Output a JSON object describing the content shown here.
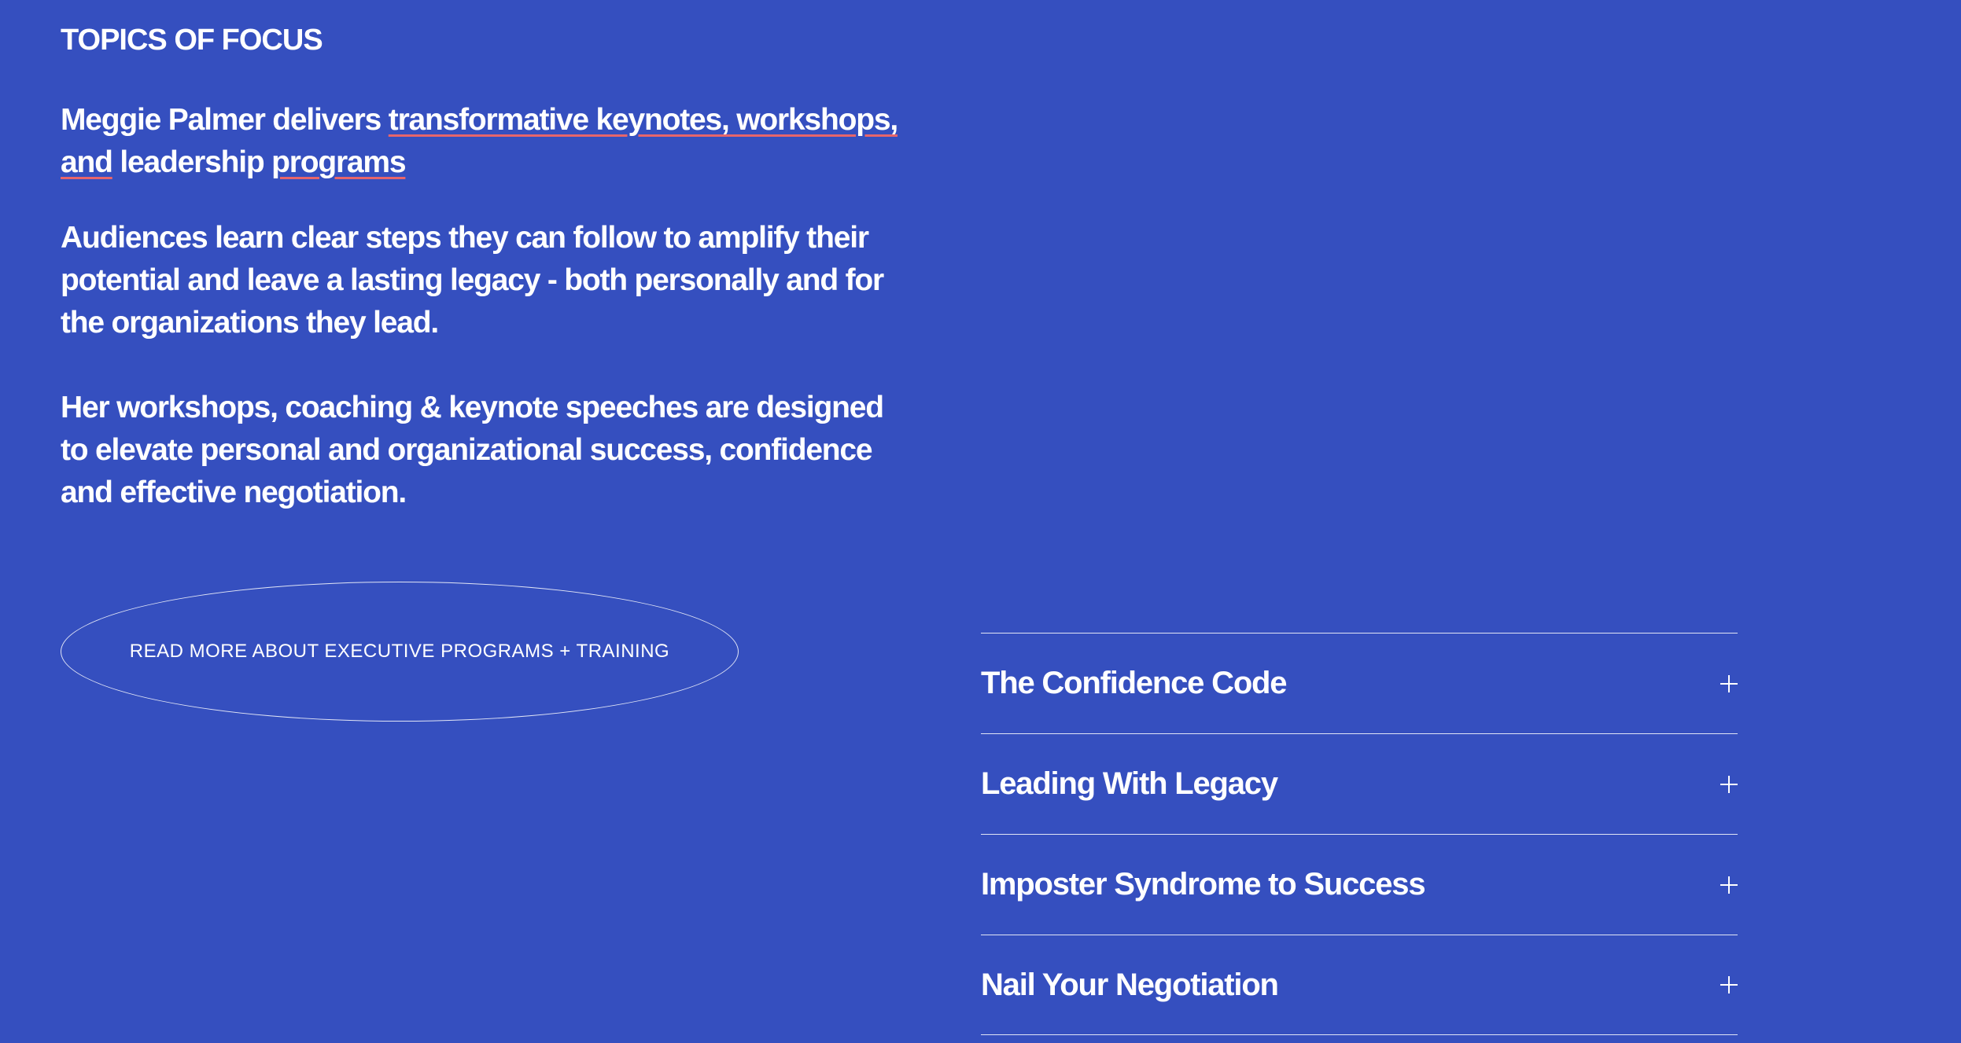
{
  "section_label": "TOPICS OF FOCUS",
  "lead": {
    "prefix": "Meggie Palmer delivers ",
    "highlight_1": "transformative keynotes, workshops, and",
    "middle": " leadership ",
    "highlight_2": "programs"
  },
  "paragraphs": {
    "p1": "Audiences learn clear steps they can follow to amplify their potential and leave a lasting legacy - both personally and for the organizations they lead.",
    "p2": "Her workshops, coaching & keynote speeches are  designed to elevate personal and organizational success, confidence and effective negotiation."
  },
  "cta": {
    "label": "READ MORE ABOUT EXECUTIVE PROGRAMS + TRAINING"
  },
  "topics": [
    {
      "title": "The Confidence Code",
      "icon": "plus-icon"
    },
    {
      "title": "Leading With Legacy",
      "icon": "plus-icon"
    },
    {
      "title": "Imposter Syndrome to Success",
      "icon": "plus-icon"
    },
    {
      "title": "Nail Your Negotiation",
      "icon": "plus-icon"
    }
  ],
  "colors": {
    "background": "#354fbf",
    "text": "#ffffff",
    "underline_accent": "#e7656b"
  }
}
